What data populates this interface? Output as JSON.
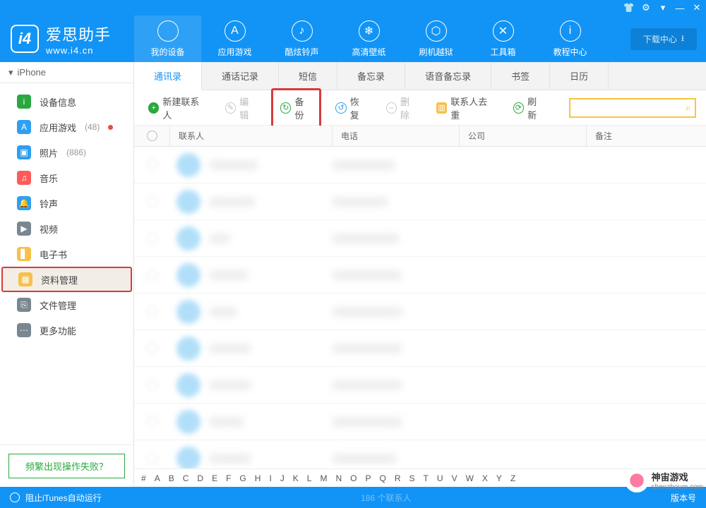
{
  "titlebar_icons": [
    "tshirt",
    "gear",
    "dropdown",
    "minimize",
    "close"
  ],
  "brand": {
    "name": "爱思助手",
    "url": "www.i4.cn"
  },
  "download_btn": "下载中心",
  "header_nav": [
    {
      "label": "我的设备",
      "icon": ""
    },
    {
      "label": "应用游戏",
      "icon": "A"
    },
    {
      "label": "酷炫铃声",
      "icon": "♪"
    },
    {
      "label": "高清壁纸",
      "icon": "❄"
    },
    {
      "label": "刷机越狱",
      "icon": "⬡"
    },
    {
      "label": "工具箱",
      "icon": "✕"
    },
    {
      "label": "教程中心",
      "icon": "i"
    }
  ],
  "device_name": "iPhone",
  "sidebar": [
    {
      "label": "设备信息",
      "color": "#2aa83f",
      "icon": "i"
    },
    {
      "label": "应用游戏",
      "color": "#2f9ff1",
      "icon": "A",
      "count": "(48)",
      "dot": true
    },
    {
      "label": "照片",
      "color": "#2f9ff1",
      "icon": "▣",
      "count": "(886)"
    },
    {
      "label": "音乐",
      "color": "#ff5a5a",
      "icon": "♫"
    },
    {
      "label": "铃声",
      "color": "#2f9ff1",
      "icon": "🔔"
    },
    {
      "label": "视频",
      "color": "#7a8790",
      "icon": "▶"
    },
    {
      "label": "电子书",
      "color": "#f6c14a",
      "icon": "▋"
    },
    {
      "label": "资料管理",
      "color": "#f6c14a",
      "icon": "▦",
      "highlighted": true
    },
    {
      "label": "文件管理",
      "color": "#7a8790",
      "icon": "⎘"
    },
    {
      "label": "更多功能",
      "color": "#7a8790",
      "icon": "⋯"
    }
  ],
  "fail_btn": "频繁出现操作失败？",
  "tabs": [
    "通讯录",
    "通话记录",
    "短信",
    "备忘录",
    "语音备忘录",
    "书签",
    "日历"
  ],
  "toolbar": {
    "new": "新建联系人",
    "edit": "编辑",
    "backup": "备份",
    "restore": "恢复",
    "delete": "删除",
    "dedupe": "联系人去重",
    "refresh": "刷新"
  },
  "columns": {
    "contact": "联系人",
    "phone": "电话",
    "company": "公司",
    "note": "备注"
  },
  "row_widths": [
    {
      "n": 70,
      "p": 90
    },
    {
      "n": 66,
      "p": 80
    },
    {
      "n": 30,
      "p": 96
    },
    {
      "n": 56,
      "p": 100
    },
    {
      "n": 40,
      "p": 100
    },
    {
      "n": 60,
      "p": 100
    },
    {
      "n": 60,
      "p": 100
    },
    {
      "n": 50,
      "p": 100
    },
    {
      "n": 60,
      "p": 92
    }
  ],
  "alpha": [
    "#",
    "A",
    "B",
    "C",
    "D",
    "E",
    "F",
    "G",
    "H",
    "I",
    "J",
    "K",
    "L",
    "M",
    "N",
    "O",
    "P",
    "Q",
    "R",
    "S",
    "T",
    "U",
    "V",
    "W",
    "X",
    "Y",
    "Z"
  ],
  "status": {
    "left": "阻止iTunes自动运行",
    "center": "186 个联系人",
    "right": "版本号"
  },
  "watermark": {
    "title": "神宙游戏",
    "sub": "shenzhoum.com"
  }
}
